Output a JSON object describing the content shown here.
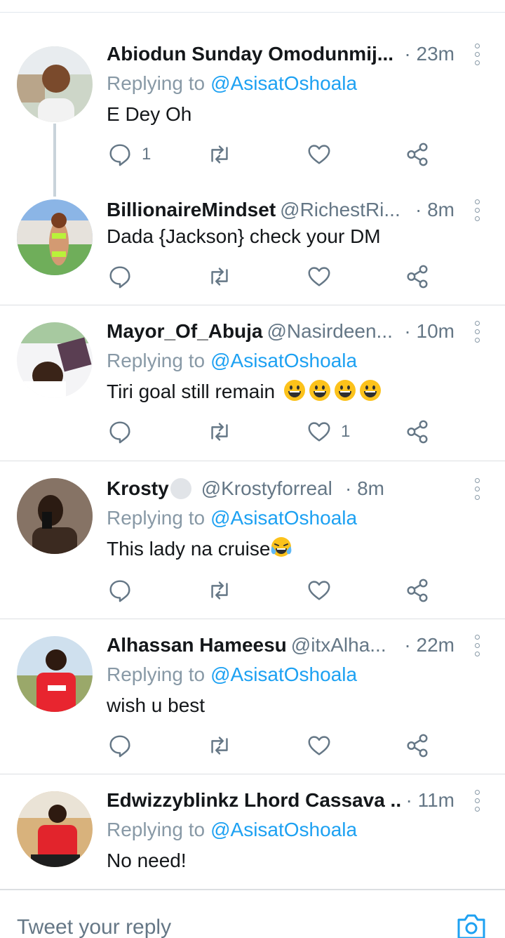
{
  "colors": {
    "link": "#1da1f2",
    "secondary": "#657786",
    "divider": "#dcdfe2"
  },
  "icons": {
    "reply": "speech-bubble-icon",
    "retweet": "retweet-arrows-icon",
    "like": "heart-outline-icon",
    "share": "share-nodes-icon",
    "more": "vertical-dots-icon",
    "camera": "camera-icon"
  },
  "tweets": [
    {
      "name": "Abiodun Sunday Omodunmij...",
      "handle": "",
      "time": "· 23m",
      "reply_prefix": "Replying to",
      "reply_to": "@AsisatOshoala",
      "text": "E Dey Oh",
      "reply_count": "1",
      "like_count": ""
    },
    {
      "name": "BillionaireMindset",
      "handle": "@RichestRi...",
      "time": "· 8m",
      "reply_prefix": "",
      "reply_to": "",
      "text": "Dada {Jackson} check your DM",
      "reply_count": "",
      "like_count": ""
    },
    {
      "name": "Mayor_Of_Abuja",
      "handle": "@Nasirdeen...",
      "time": "· 10m",
      "reply_prefix": "Replying to",
      "reply_to": "@AsisatOshoala",
      "text": "Tiri goal still remain",
      "emojis": [
        "grinning-face-emoji",
        "grinning-face-emoji",
        "grinning-face-emoji",
        "grinning-face-emoji"
      ],
      "reply_count": "",
      "like_count": "1"
    },
    {
      "name": "Krosty",
      "handle": "@Krostyforreal",
      "time": "· 8m",
      "reply_prefix": "Replying to",
      "reply_to": "@AsisatOshoala",
      "text": "This lady na cruise",
      "emojis": [
        "tears-of-joy-emoji"
      ],
      "reply_count": "",
      "like_count": ""
    },
    {
      "name": "Alhassan Hameesu",
      "handle": "@itxAlha...",
      "time": "· 22m",
      "reply_prefix": "Replying to",
      "reply_to": "@AsisatOshoala",
      "text": "wish u best",
      "reply_count": "",
      "like_count": ""
    },
    {
      "name": "Edwizzyblinkz Lhord Cassava ...",
      "handle": "",
      "time": "· 11m",
      "reply_prefix": "Replying to",
      "reply_to": "@AsisatOshoala",
      "text": "No need!",
      "reply_count": "",
      "like_count": ""
    }
  ],
  "composer": {
    "placeholder": "Tweet your reply"
  }
}
